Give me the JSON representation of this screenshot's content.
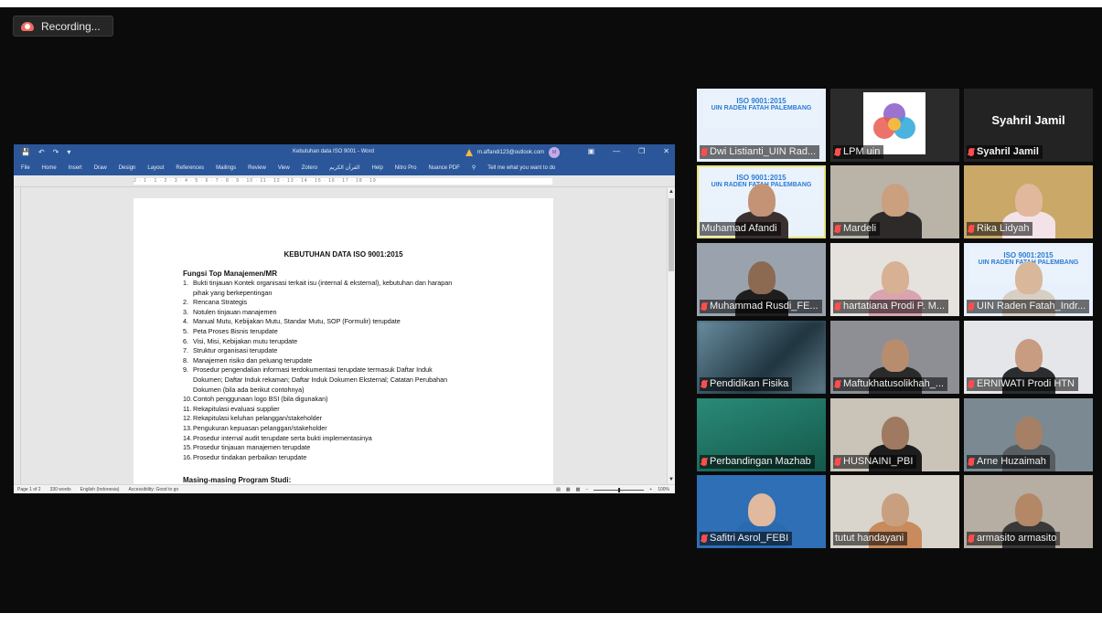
{
  "recording": {
    "label": "Recording..."
  },
  "word": {
    "title": "Kebutuhan data ISO 9001  -  Word",
    "account": "m.affandi123@outlook.com",
    "avatar_initials": "M",
    "menu": [
      "File",
      "Home",
      "Insert",
      "Draw",
      "Design",
      "Layout",
      "References",
      "Mailings",
      "Review",
      "View",
      "Zotero",
      "القرآن الكريم",
      "Help",
      "Nitro Pro",
      "Nuance PDF"
    ],
    "tell_me": "Tell me what you want to do",
    "ruler_text": "2 · 1 · 1 · 2 · 3 · 4 · 5 · 6 · 7 · 8 · 9 · 10 · 11 · 12 · 13 · 14 · 15 · 16 · 17 · 18 · 19",
    "doc": {
      "heading": "KEBUTUHAN DATA ISO 9001:2015",
      "section1": "Fungsi Top Manajemen/MR",
      "items": [
        {
          "n": "1.",
          "t": "Bukti tinjauan Kontek organisasi terkait isu (internal & eksternal), kebutuhan dan harapan"
        },
        {
          "n": "",
          "t": "pihak yang berkepentingan"
        },
        {
          "n": "2.",
          "t": "Rencana Strategis"
        },
        {
          "n": "3.",
          "t": "Notulen tinjauan manajemen"
        },
        {
          "n": "4.",
          "t": "Manual Mutu, Kebijakan Mutu, Standar Mutu, SOP (Formulir) terupdate"
        },
        {
          "n": "5.",
          "t": "Peta Proses Bisnis terupdate"
        },
        {
          "n": "6.",
          "t": "Visi, Misi, Kebijakan mutu terupdate"
        },
        {
          "n": "7.",
          "t": "Struktur organisasi terupdate"
        },
        {
          "n": "8.",
          "t": "Manajemen risiko dan peluang terupdate"
        },
        {
          "n": "9.",
          "t": "Prosedur pengendalian informasi terdokumentasi terupdate termasuk Daftar Induk"
        },
        {
          "n": "",
          "t": "Dokumen; Daftar Induk rekaman; Daftar Induk Dokumen Eksternal; Catatan Perubahan"
        },
        {
          "n": "",
          "t": "Dokumen (bila ada berikut contohnya)"
        },
        {
          "n": "10.",
          "t": "Contoh penggunaan logo BSI (bila digunakan)"
        },
        {
          "n": "11.",
          "t": "Rekapitulasi evaluasi supplier"
        },
        {
          "n": "12.",
          "t": "Rekapitulasi keluhan pelanggan/stakeholder"
        },
        {
          "n": "13.",
          "t": "Pengukuran kepuasan pelanggan/stakeholder"
        },
        {
          "n": "14.",
          "t": "Prosedur internal audit terupdate serta bukti implementasinya"
        },
        {
          "n": "15.",
          "t": "Prosedur tinjauan manajemen terupdate"
        },
        {
          "n": "16.",
          "t": "Prosedur tindakan perbaikan terupdate"
        }
      ],
      "section2": "Masing-masing Program Studi:"
    },
    "status": {
      "page": "Page 1 of 2",
      "words": "330 words",
      "language": "English (Indonesia)",
      "accessibility": "Accessibility: Good to go",
      "zoom": "100%"
    }
  },
  "slide": {
    "title1": "ISO 9001:2015",
    "title2": "UIN RADEN FATAH PALEMBANG"
  },
  "participants": [
    {
      "name": "Dwi Listianti_UIN Rad...",
      "muted": true
    },
    {
      "name": "LPM uin",
      "muted": true
    },
    {
      "name": "Syahril Jamil",
      "muted": true,
      "display": "Syahril Jamil"
    },
    {
      "name": "Muhamad Afandi",
      "muted": false,
      "active": true
    },
    {
      "name": "Mardeli",
      "muted": true
    },
    {
      "name": "Rika Lidyah",
      "muted": true
    },
    {
      "name": "Muhammad Rusdi_FE...",
      "muted": true
    },
    {
      "name": "hartatiana Prodi P. M...",
      "muted": true
    },
    {
      "name": "UIN Raden Fatah_Indr...",
      "muted": true
    },
    {
      "name": "Pendidikan Fisika",
      "muted": true
    },
    {
      "name": "Maftukhatusolikhah_...",
      "muted": true
    },
    {
      "name": "ERNIWATI Prodi HTN",
      "muted": true
    },
    {
      "name": "Perbandingan Mazhab",
      "muted": true
    },
    {
      "name": "HUSNAINI_PBI",
      "muted": true
    },
    {
      "name": "Arne Huzaimah",
      "muted": true
    },
    {
      "name": "Safitri Asrol_FEBI",
      "muted": true
    },
    {
      "name": "tutut handayani",
      "muted": false
    },
    {
      "name": "armasito armasito",
      "muted": true
    }
  ]
}
